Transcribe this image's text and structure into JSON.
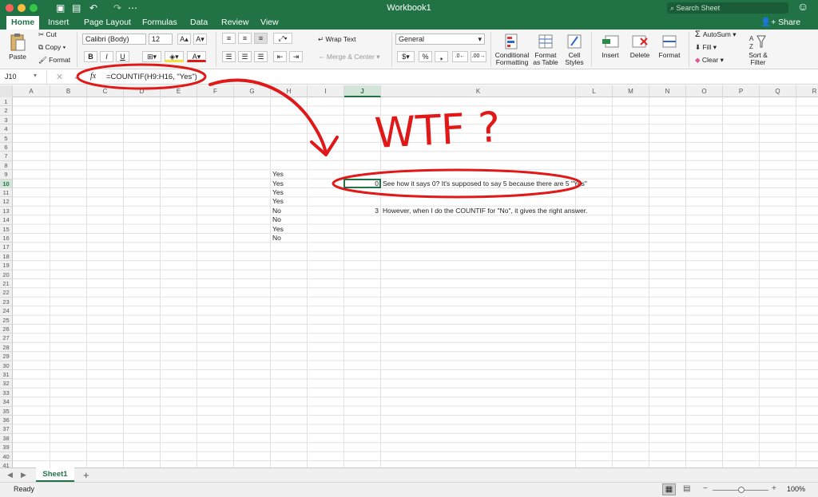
{
  "window": {
    "title": "Workbook1",
    "search_placeholder": "Search Sheet",
    "share_label": "Share"
  },
  "tabs": [
    "Home",
    "Insert",
    "Page Layout",
    "Formulas",
    "Data",
    "Review",
    "View"
  ],
  "ribbon": {
    "paste": "Paste",
    "cut": "Cut",
    "copy": "Copy",
    "format_painter": "Format",
    "font_name": "Calibri (Body)",
    "font_size": "12",
    "wrap_text": "Wrap Text",
    "merge_center": "Merge & Center",
    "number_format": "General",
    "conditional_formatting_1": "Conditional",
    "conditional_formatting_2": "Formatting",
    "format_as_table_1": "Format",
    "format_as_table_2": "as Table",
    "cell_styles_1": "Cell",
    "cell_styles_2": "Styles",
    "insert": "Insert",
    "delete": "Delete",
    "format": "Format",
    "autosum": "AutoSum",
    "fill": "Fill",
    "clear": "Clear",
    "sort_filter_1": "Sort &",
    "sort_filter_2": "Filter"
  },
  "formula_bar": {
    "name_box": "J10",
    "fx": "fx",
    "formula": "=COUNTIF(H9:H16, \"Yes\")"
  },
  "columns": [
    "A",
    "B",
    "C",
    "D",
    "E",
    "F",
    "G",
    "H",
    "I",
    "J",
    "K",
    "L",
    "M",
    "N",
    "O",
    "P",
    "Q",
    "R"
  ],
  "rows": [
    "1",
    "2",
    "3",
    "4",
    "5",
    "6",
    "7",
    "8",
    "9",
    "10",
    "11",
    "12",
    "13",
    "14",
    "15",
    "16",
    "17",
    "18",
    "19",
    "20",
    "21",
    "22",
    "23",
    "24",
    "25",
    "26",
    "27",
    "28",
    "29",
    "30",
    "31",
    "32",
    "33",
    "34",
    "35",
    "36",
    "37",
    "38",
    "39",
    "40",
    "41"
  ],
  "cells": {
    "H9": "Yes",
    "H10": "Yes",
    "H11": "Yes",
    "H12": "Yes",
    "H13": "No",
    "H14": "No",
    "H15": "Yes",
    "H16": "No",
    "J10": "0",
    "J13": "3",
    "K10": "See how it says 0? It's supposed to say 5 because there are 5 \"Yes\"",
    "K13": "However, when I do the COUNTIF for \"No\", it gives the right answer."
  },
  "annotation": {
    "text": "WTF ?",
    "color": "#e01818"
  },
  "sheets": [
    "Sheet1"
  ],
  "status": {
    "ready": "Ready",
    "zoom": "100%"
  },
  "colors": {
    "accent": "#217346"
  }
}
